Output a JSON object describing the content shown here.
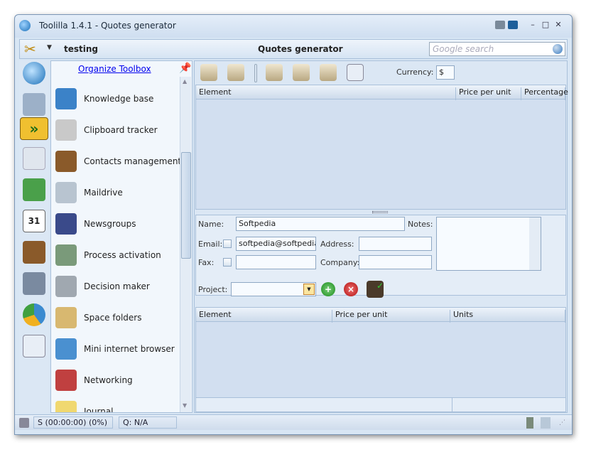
{
  "window": {
    "title": "Toolilla 1.4.1 - Quotes generator",
    "buttons": [
      "monitor",
      "minimize",
      "maximize",
      "close"
    ]
  },
  "header": {
    "profile": "testing",
    "module_title": "Quotes generator",
    "search_placeholder": "Google search"
  },
  "left_icons": [
    "toolilla-logo",
    "search-computer",
    "fast-forward",
    "mail",
    "money",
    "calendar-31",
    "contacts",
    "network-computer",
    "pie-chart",
    "search-document"
  ],
  "toolbox": {
    "link": "Organize Toolbox",
    "items": [
      {
        "label": "Knowledge base",
        "icon": "book-icon",
        "color": "#3b82c8"
      },
      {
        "label": "Clipboard tracker",
        "icon": "clipboard-icon",
        "color": "#c9c9c9"
      },
      {
        "label": "Contacts management",
        "icon": "contacts-icon",
        "color": "#8a5a2a"
      },
      {
        "label": "Maildrive",
        "icon": "mail-drive-icon",
        "color": "#b8c4d0"
      },
      {
        "label": "Newsgroups",
        "icon": "person-icon",
        "color": "#3a4a8a"
      },
      {
        "label": "Process activation",
        "icon": "gears-icon",
        "color": "#7a9a7a"
      },
      {
        "label": "Decision maker",
        "icon": "calculator-icon",
        "color": "#a0a8b0"
      },
      {
        "label": "Space folders",
        "icon": "folder-icon",
        "color": "#d8b870"
      },
      {
        "label": "Mini internet browser",
        "icon": "browser-icon",
        "color": "#4a90d0"
      },
      {
        "label": "Networking",
        "icon": "network-people-icon",
        "color": "#c04040"
      },
      {
        "label": "Journal",
        "icon": "journal-icon",
        "color": "#f0d870"
      }
    ]
  },
  "toolbar": {
    "currency_label": "Currency:",
    "currency_value": "$",
    "tools": [
      "add-quote",
      "delete-quote",
      "settings-quote",
      "refresh-quote",
      "save-quote",
      "preview-quote"
    ]
  },
  "upper_grid": {
    "columns": [
      "Element",
      "Price per unit",
      "Percentage"
    ]
  },
  "form": {
    "name_label": "Name:",
    "name_value": "Softpedia",
    "notes_label": "Notes:",
    "email_label": "Email:",
    "email_value": "softpedia@softpedia.c",
    "address_label": "Address:",
    "fax_label": "Fax:",
    "company_label": "Company:",
    "project_label": "Project:"
  },
  "lower_grid": {
    "columns": [
      "Element",
      "Price per unit",
      "Units"
    ]
  },
  "status": {
    "timer": "S (00:00:00) (0%)",
    "queue": "Q: N/A"
  }
}
